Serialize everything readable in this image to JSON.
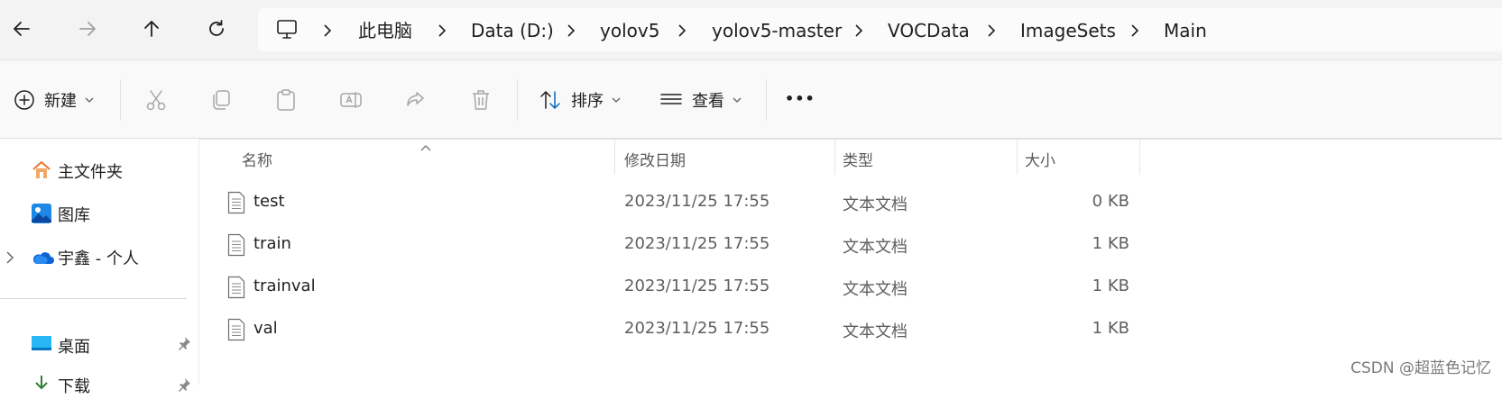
{
  "nav": {
    "back_icon": "arrow-left-icon",
    "forward_icon": "arrow-right-icon",
    "up_icon": "arrow-up-icon",
    "refresh_icon": "refresh-icon"
  },
  "breadcrumb": [
    "此电脑",
    "Data (D:)",
    "yolov5",
    "yolov5-master",
    "VOCData",
    "ImageSets",
    "Main"
  ],
  "toolbar": {
    "new_label": "新建",
    "sort_label": "排序",
    "view_label": "查看",
    "more_label": "•••"
  },
  "sidebar": {
    "items": [
      {
        "label": "主文件夹",
        "icon": "home-icon"
      },
      {
        "label": "图库",
        "icon": "gallery-icon"
      },
      {
        "label": "宇鑫 - 个人",
        "icon": "onedrive-cloud-icon"
      },
      {
        "label": "桌面",
        "icon": "desktop-icon"
      },
      {
        "label": "下载",
        "icon": "download-icon"
      }
    ]
  },
  "columns": {
    "name": "名称",
    "date": "修改日期",
    "type": "类型",
    "size": "大小"
  },
  "files": [
    {
      "name": "test",
      "date": "2023/11/25 17:55",
      "type": "文本文档",
      "size": "0 KB"
    },
    {
      "name": "train",
      "date": "2023/11/25 17:55",
      "type": "文本文档",
      "size": "1 KB"
    },
    {
      "name": "trainval",
      "date": "2023/11/25 17:55",
      "type": "文本文档",
      "size": "1 KB"
    },
    {
      "name": "val",
      "date": "2023/11/25 17:55",
      "type": "文本文档",
      "size": "1 KB"
    }
  ],
  "watermark": "CSDN @超蓝色记忆",
  "colors": {
    "accent": "#0067c0",
    "chrome": "#f3f3f3",
    "toolbar": "#f9f9f9"
  }
}
